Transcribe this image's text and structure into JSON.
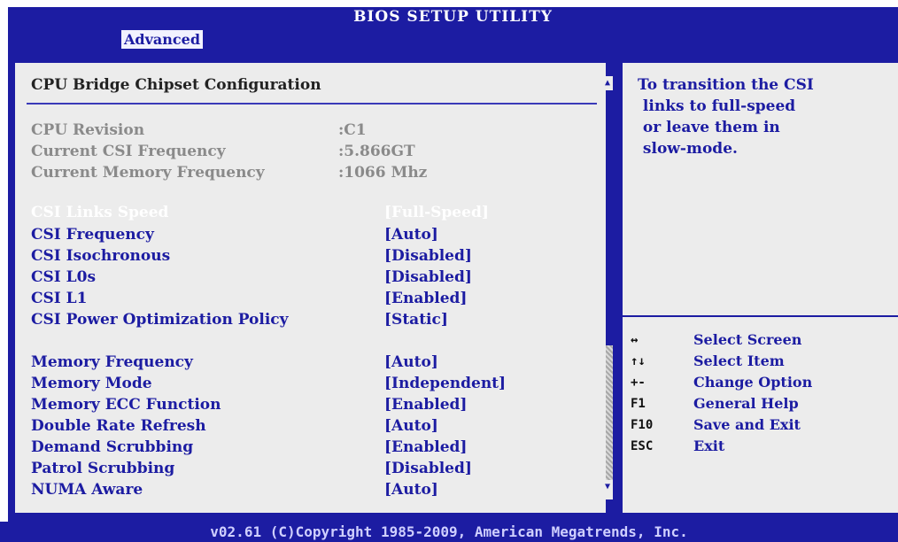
{
  "header": {
    "title": "BIOS SETUP UTILITY",
    "active_tab": "Advanced"
  },
  "section_title": "CPU Bridge Chipset Configuration",
  "info_rows": [
    {
      "label": "CPU Revision",
      "value": ":C1"
    },
    {
      "label": "Current CSI Frequency",
      "value": ":5.866GT"
    },
    {
      "label": "Current Memory Frequency",
      "value": ":1066 Mhz"
    }
  ],
  "settings": [
    {
      "label": "CSI Links Speed",
      "value": "[Full-Speed]",
      "selected": true
    },
    {
      "label": "CSI Frequency",
      "value": "[Auto]"
    },
    {
      "label": "CSI Isochronous",
      "value": "[Disabled]"
    },
    {
      "label": "CSI L0s",
      "value": "[Disabled]"
    },
    {
      "label": "CSI L1",
      "value": "[Enabled]"
    },
    {
      "label": "CSI Power Optimization Policy",
      "value": "[Static]"
    },
    {
      "label": "Memory Frequency",
      "value": "[Auto]"
    },
    {
      "label": "Memory Mode",
      "value": "[Independent]"
    },
    {
      "label": "Memory ECC Function",
      "value": "[Enabled]"
    },
    {
      "label": "Double Rate Refresh",
      "value": "[Auto]"
    },
    {
      "label": "Demand Scrubbing",
      "value": "[Enabled]"
    },
    {
      "label": "Patrol Scrubbing",
      "value": "[Disabled]"
    },
    {
      "label": "NUMA Aware",
      "value": "[Auto]"
    }
  ],
  "help_text": [
    "To transition the CSI",
    " links to full-speed",
    " or leave them in",
    " slow-mode."
  ],
  "key_help": [
    {
      "key": "↔",
      "action": "Select Screen"
    },
    {
      "key": "↑↓",
      "action": "Select Item"
    },
    {
      "key": "+-",
      "action": "Change Option"
    },
    {
      "key": "F1",
      "action": "General Help"
    },
    {
      "key": "F10",
      "action": "Save and Exit"
    },
    {
      "key": "ESC",
      "action": "Exit"
    }
  ],
  "footer": "v02.61 (C)Copyright 1985-2009, American Megatrends, Inc.",
  "colors": {
    "background": "#1c1ca2",
    "panel": "#ececec",
    "selected": "#ffffff",
    "inactive": "#8a8a8a"
  }
}
